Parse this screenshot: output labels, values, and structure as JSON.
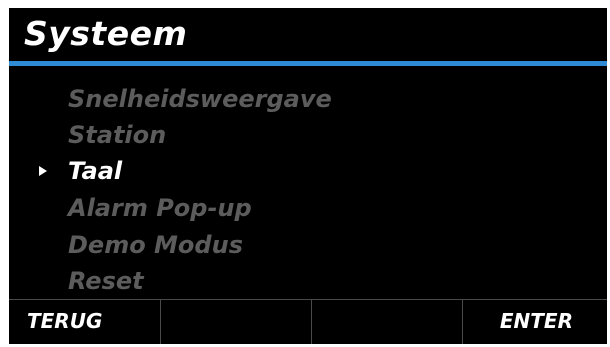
{
  "header": {
    "title": "Systeem"
  },
  "menu": {
    "items": [
      {
        "label": "Snelheidsweergave",
        "selected": false
      },
      {
        "label": "Station",
        "selected": false
      },
      {
        "label": "Taal",
        "selected": true
      },
      {
        "label": "Alarm Pop-up",
        "selected": false
      },
      {
        "label": "Demo Modus",
        "selected": false
      },
      {
        "label": "Reset",
        "selected": false
      }
    ]
  },
  "softkeys": {
    "left": "TERUG",
    "middle_left": "",
    "middle_right": "",
    "right": "ENTER"
  },
  "colors": {
    "background": "#000000",
    "accent": "#2f8bd4",
    "text_selected": "#ffffff",
    "text_unselected": "#5c5c5c"
  },
  "icons": {
    "selection_pointer": "triangle-right"
  }
}
